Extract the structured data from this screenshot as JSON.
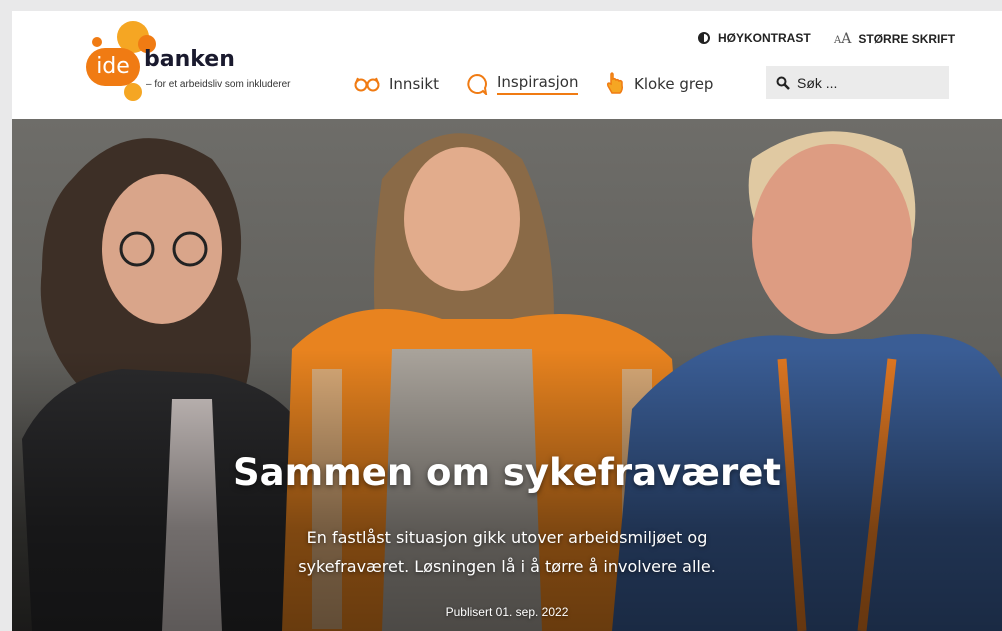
{
  "logo": {
    "badge": "ide",
    "word": "banken",
    "tagline": "– for et arbeidsliv som inkluderer"
  },
  "utility": {
    "contrast_label": "HØYKONTRAST",
    "font_size_label": "STØRRE SKRIFT"
  },
  "nav": {
    "items": [
      {
        "label": "Innsikt",
        "icon": "glasses-icon"
      },
      {
        "label": "Inspirasjon",
        "icon": "speech-bubble-icon",
        "active": true
      },
      {
        "label": "Kloke grep",
        "icon": "hand-pointing-icon"
      }
    ]
  },
  "search": {
    "placeholder": "Søk ..."
  },
  "hero": {
    "title": "Sammen om sykefraværet",
    "lead": "En fastlåst situasjon gikk utover arbeidsmiljøet og sykefraværet. Løsningen lå i å tørre å involvere alle.",
    "published": "Publisert 01. sep. 2022"
  },
  "colors": {
    "accent": "#f07b13",
    "accent_light": "#f5a623",
    "text_dark": "#222222",
    "search_bg": "#ebebeb"
  }
}
